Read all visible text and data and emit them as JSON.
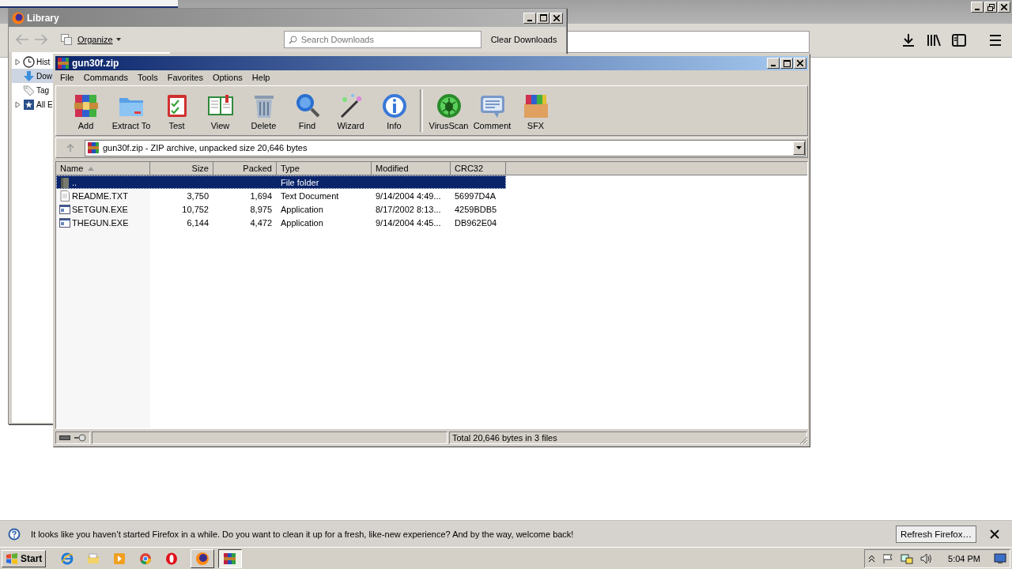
{
  "firefox": {
    "notification": {
      "text": "It looks like you haven’t started Firefox in a while. Do you want to clean it up for a fresh, like-new experience? And by the way, welcome back!",
      "button": "Refresh Firefox…"
    }
  },
  "library": {
    "title": "Library",
    "organize": "Organize",
    "search": {
      "placeholder": "Search Downloads"
    },
    "clear_button": "Clear Downloads",
    "tree": [
      {
        "label": "Hist",
        "kind": "history",
        "expanded": false,
        "selected": false
      },
      {
        "label": "Dow",
        "kind": "downloads",
        "selected": true
      },
      {
        "label": "Tag",
        "kind": "tags",
        "selected": false
      },
      {
        "label": "All E",
        "kind": "bookmarks",
        "expanded": false,
        "selected": false
      }
    ]
  },
  "winrar": {
    "title": "gun30f.zip",
    "menu": [
      "File",
      "Commands",
      "Tools",
      "Favorites",
      "Options",
      "Help"
    ],
    "toolbar": [
      [
        {
          "label": "Add",
          "kind": "add"
        },
        {
          "label": "Extract To",
          "kind": "extract"
        },
        {
          "label": "Test",
          "kind": "test"
        },
        {
          "label": "View",
          "kind": "view"
        },
        {
          "label": "Delete",
          "kind": "delete"
        },
        {
          "label": "Find",
          "kind": "find"
        },
        {
          "label": "Wizard",
          "kind": "wizard"
        },
        {
          "label": "Info",
          "kind": "info"
        }
      ],
      [
        {
          "label": "VirusScan",
          "kind": "virus"
        },
        {
          "label": "Comment",
          "kind": "comment"
        },
        {
          "label": "SFX",
          "kind": "sfx"
        }
      ]
    ],
    "path": "gun30f.zip - ZIP archive, unpacked size 20,646 bytes",
    "columns": [
      {
        "label": "Name",
        "sorted": true
      },
      {
        "label": "Size",
        "sorted": false
      },
      {
        "label": "Packed",
        "sorted": false
      },
      {
        "label": "Type",
        "sorted": false
      },
      {
        "label": "Modified",
        "sorted": false
      },
      {
        "label": "CRC32",
        "sorted": false
      }
    ],
    "rows": [
      {
        "kind": "folder",
        "selected": true,
        "name": "..",
        "type": "File folder"
      },
      {
        "kind": "text",
        "selected": false,
        "name": "README.TXT",
        "size": "3,750",
        "packed": "1,694",
        "type": "Text Document",
        "modified": "9/14/2004 4:49...",
        "crc": "56997D4A"
      },
      {
        "kind": "app",
        "selected": false,
        "name": "SETGUN.EXE",
        "size": "10,752",
        "packed": "8,975",
        "type": "Application",
        "modified": "8/17/2002 8:13...",
        "crc": "4259BDB5"
      },
      {
        "kind": "app",
        "selected": false,
        "name": "THEGUN.EXE",
        "size": "6,144",
        "packed": "4,472",
        "type": "Application",
        "modified": "9/14/2004 4:45...",
        "crc": "DB962E04"
      }
    ],
    "status": "Total 20,646 bytes in 3 files"
  },
  "taskbar": {
    "start": "Start",
    "apps": [
      {
        "kind": "firefox",
        "selected": false
      },
      {
        "kind": "winrar",
        "selected": true
      }
    ],
    "time": "5:04 PM"
  }
}
